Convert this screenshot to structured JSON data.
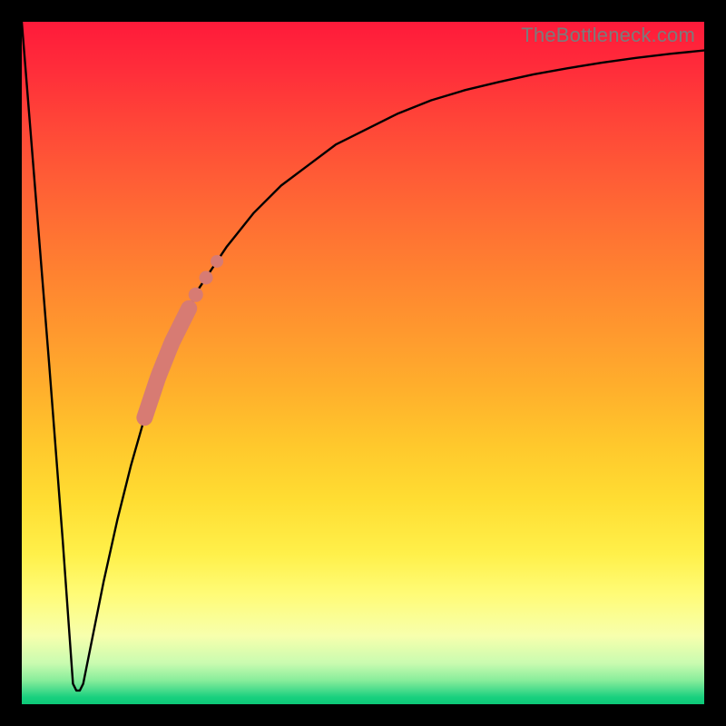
{
  "attribution": "TheBottleneck.com",
  "colors": {
    "frame": "#000000",
    "curve_stroke": "#000000",
    "marker_fill": "#d77b73",
    "gradient_top": "#ff1a3a",
    "gradient_bottom": "#0dc878"
  },
  "chart_data": {
    "type": "line",
    "title": "",
    "xlabel": "",
    "ylabel": "",
    "xlim": [
      0,
      100
    ],
    "ylim": [
      0,
      100
    ],
    "notes": "Bottleneck-style curve: y is bottleneck % (0 at bottom, 100 at top). Sharp V-shaped minimum near x≈8, then asymptotic rise toward ~95–97.",
    "series": [
      {
        "name": "bottleneck-curve",
        "x": [
          0,
          2,
          4,
          6,
          7,
          7.5,
          8,
          8.5,
          9,
          10,
          12,
          14,
          16,
          18,
          20,
          22,
          24,
          26,
          28,
          30,
          34,
          38,
          42,
          46,
          50,
          55,
          60,
          65,
          70,
          75,
          80,
          85,
          90,
          95,
          100
        ],
        "values": [
          100,
          75,
          50,
          24,
          10,
          3,
          2,
          2,
          3,
          8,
          18,
          27,
          35,
          42,
          48,
          53,
          57,
          61,
          64,
          67,
          72,
          76,
          79,
          82,
          84,
          86.5,
          88.5,
          90,
          91.2,
          92.3,
          93.2,
          94,
          94.7,
          95.3,
          95.8
        ]
      }
    ],
    "markers": {
      "name": "highlight-segment",
      "style": "thick-rounded-with-dots",
      "color": "#d77b73",
      "thick_segment_x": [
        18,
        24.5
      ],
      "dots_x": [
        25.5,
        27,
        28.6
      ]
    }
  }
}
